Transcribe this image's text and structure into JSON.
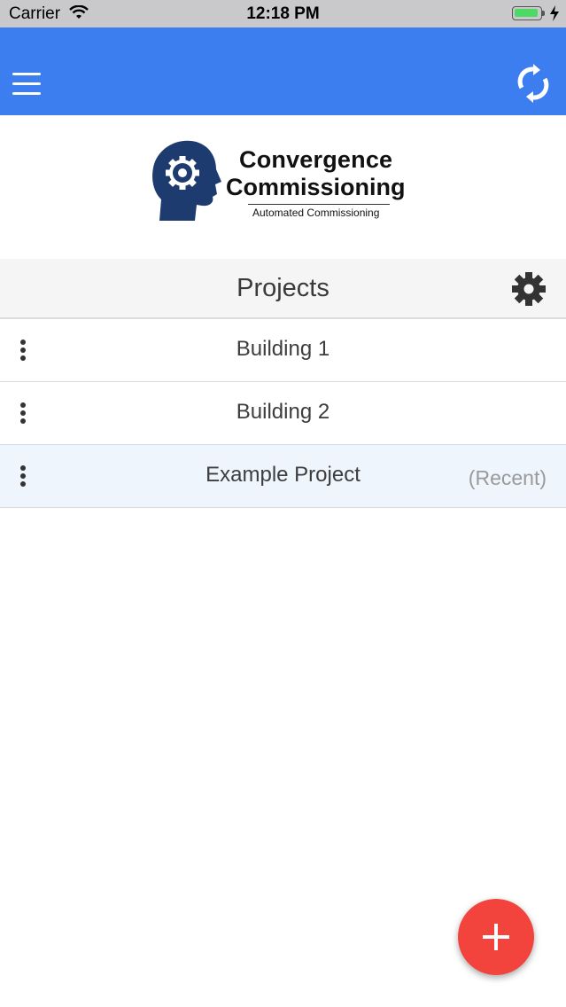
{
  "status_bar": {
    "carrier": "Carrier",
    "time": "12:18 PM",
    "battery_color": "#4cd964"
  },
  "app_bar": {
    "color": "#3c7ef0",
    "left_icon": "menu-icon",
    "right_icon": "refresh-icon"
  },
  "logo": {
    "line1": "Convergence",
    "line2": "Commissioning",
    "tagline": "Automated Commissioning",
    "head_color": "#1d3b6e"
  },
  "projects": {
    "title": "Projects",
    "settings_icon": "gear-icon",
    "items": [
      {
        "label": "Building 1",
        "recent_label": ""
      },
      {
        "label": "Building 2",
        "recent_label": ""
      },
      {
        "label": "Example Project",
        "recent_label": "(Recent)"
      }
    ]
  },
  "fab": {
    "icon": "plus-icon",
    "color": "#f2433c"
  }
}
